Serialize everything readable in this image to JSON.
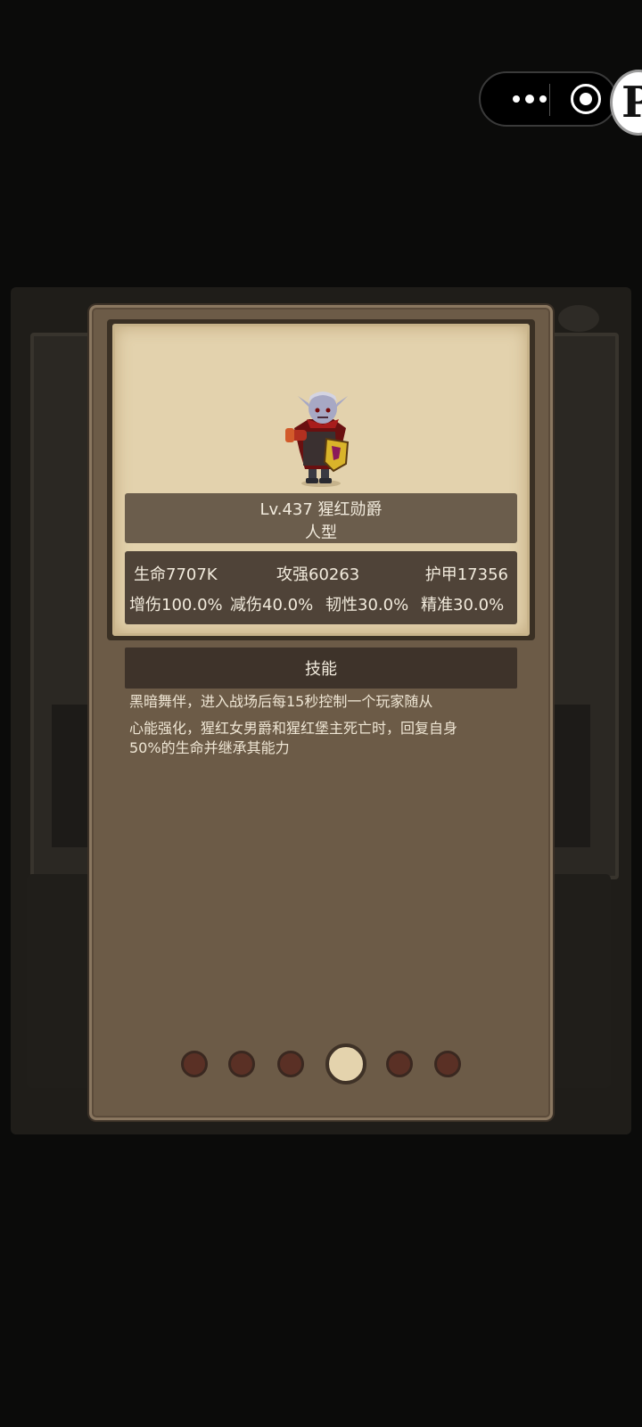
{
  "monster": {
    "level_name": "Lv.437 猩红勋爵",
    "type": "人型"
  },
  "stats": {
    "hp": "生命7707K",
    "attack": "攻强60263",
    "armor": "护甲17356",
    "dmg_increase": "增伤100.0%",
    "dmg_reduce": "减伤40.0%",
    "toughness": "韧性30.0%",
    "accuracy": "精准30.0%"
  },
  "skill": {
    "header": "技能",
    "line1": "黑暗舞伴，进入战场后每15秒控制一个玩家随从",
    "line2": "心能强化，猩红女男爵和猩红堡主死亡时，回复自身",
    "line3": "50%的生命并继承其能力"
  },
  "pagination": {
    "total": 6,
    "current": 4
  },
  "colors": {
    "parchment": "#e3d2ad",
    "panel": "#6c5b47",
    "dot": "#5a3025",
    "dot_active": "#e4d3ad"
  },
  "icons": {
    "more": "more-dots-icon",
    "close": "close-circle-icon"
  }
}
